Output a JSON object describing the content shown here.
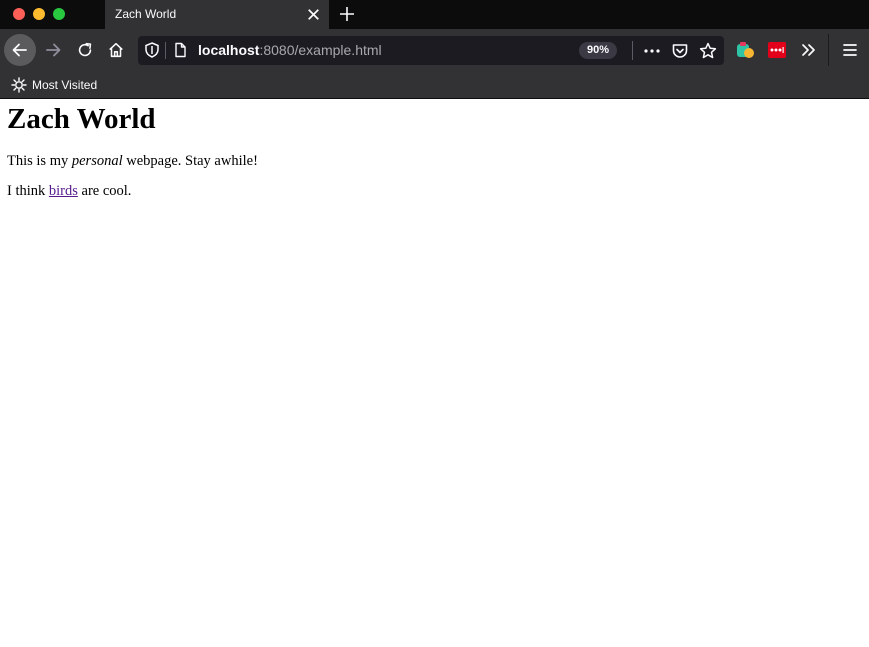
{
  "browser": {
    "tab": {
      "title": "Zach World"
    },
    "address": {
      "host": "localhost",
      "rest": ":8080/example.html",
      "zoom": "90%"
    },
    "bookmarks": [
      {
        "label": "Most Visited"
      }
    ]
  },
  "page": {
    "heading": "Zach World",
    "para1": {
      "before": "This is my",
      "emphasis": "personal",
      "after": "webpage. Stay awhile!"
    },
    "para2": {
      "before": "I think",
      "link": "birds",
      "after": "are cool."
    }
  },
  "colors": {
    "chrome_dark": "#0c0c0d",
    "chrome": "#323234",
    "urlbar": "#1c1b22",
    "visited_link": "#551a8b"
  }
}
